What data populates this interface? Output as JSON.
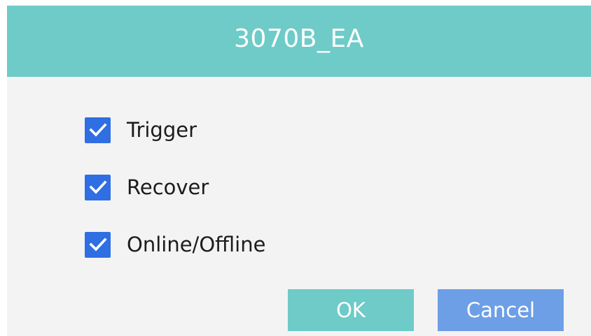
{
  "dialog": {
    "title": "3070B_EA",
    "options": [
      {
        "label": "Trigger",
        "checked": true
      },
      {
        "label": "Recover",
        "checked": true
      },
      {
        "label": "Online/Offline",
        "checked": true
      }
    ],
    "buttons": {
      "ok_label": "OK",
      "cancel_label": "Cancel"
    }
  },
  "colors": {
    "title_bar": "#6ecbc8",
    "dialog_background": "#f4f3f4",
    "checkbox": "#2f6ee3",
    "ok_button": "#6ecbc8",
    "cancel_button": "#6d9fe6"
  },
  "icons": {
    "checkbox_mark": "checkmark-icon"
  }
}
